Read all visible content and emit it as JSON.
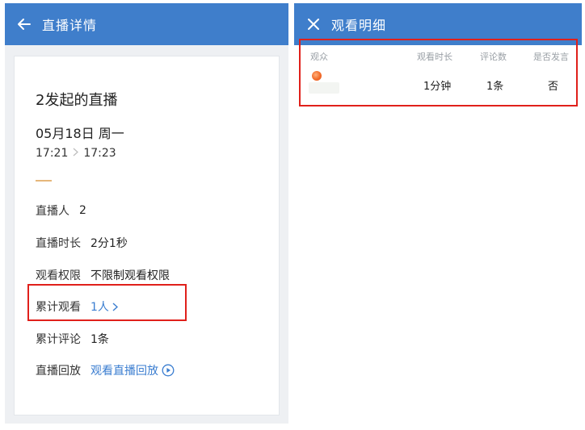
{
  "left": {
    "header_title": "直播详情",
    "live_title": "2发起的直播",
    "date": "05月18日 周一",
    "time_start": "17:21",
    "time_end": "17:23",
    "rows": [
      {
        "label": "直播人",
        "value": "2"
      },
      {
        "label": "直播时长",
        "value": "2分1秒"
      },
      {
        "label": "观看权限",
        "value": "不限制观看权限"
      },
      {
        "label": "累计观看",
        "value": "1人"
      },
      {
        "label": "累计评论",
        "value": "1条"
      },
      {
        "label": "直播回放",
        "value": "观看直播回放"
      }
    ]
  },
  "right": {
    "header_title": "观看明细",
    "columns": [
      "观众",
      "观看时长",
      "评论数",
      "是否发言"
    ],
    "rows": [
      {
        "viewer": "",
        "duration": "1分钟",
        "comments": "1条",
        "spoke": "否"
      }
    ]
  },
  "colors": {
    "appbar": "#3f7ecb",
    "link": "#3a7dd0",
    "highlight_box": "#e0201b",
    "accent_line": "#e6b77a"
  },
  "icons": {
    "back": "arrow-left-icon",
    "close": "close-icon",
    "chevron": "chevron-right-icon",
    "play": "play-circle-icon",
    "time_arrow": "chevron-right-icon"
  }
}
